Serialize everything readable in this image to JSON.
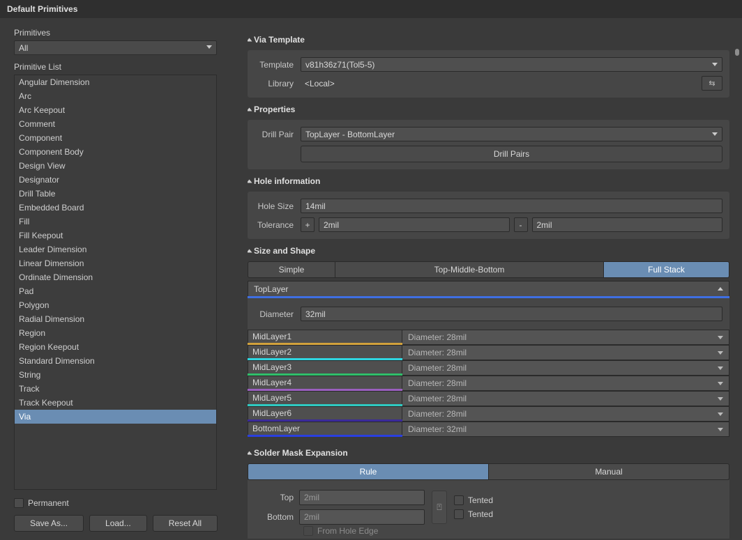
{
  "window": {
    "title": "Default Primitives"
  },
  "left": {
    "primitives_label": "Primitives",
    "primitives_value": "All",
    "list_label": "Primitive List",
    "items": [
      "Angular Dimension",
      "Arc",
      "Arc Keepout",
      "Comment",
      "Component",
      "Component Body",
      "Design View",
      "Designator",
      "Drill Table",
      "Embedded Board",
      "Fill",
      "Fill Keepout",
      "Leader Dimension",
      "Linear Dimension",
      "Ordinate Dimension",
      "Pad",
      "Polygon",
      "Radial Dimension",
      "Region",
      "Region Keepout",
      "Standard Dimension",
      "String",
      "Track",
      "Track Keepout",
      "Via"
    ],
    "selected_index": 24,
    "permanent_label": "Permanent",
    "buttons": {
      "save": "Save As...",
      "load": "Load...",
      "reset": "Reset All"
    }
  },
  "via_template": {
    "header": "Via Template",
    "template_label": "Template",
    "template_value": "v81h36z71(Tol5-5)",
    "library_label": "Library",
    "library_value": "<Local>",
    "link_icon_glyph": "⇆"
  },
  "properties": {
    "header": "Properties",
    "drill_pair_label": "Drill Pair",
    "drill_pair_value": "TopLayer - BottomLayer",
    "drill_pairs_button": "Drill Pairs"
  },
  "hole": {
    "header": "Hole information",
    "size_label": "Hole Size",
    "size_value": "14mil",
    "tolerance_label": "Tolerance",
    "plus": "+",
    "plus_value": "2mil",
    "minus": "-",
    "minus_value": "2mil"
  },
  "size_shape": {
    "header": "Size and Shape",
    "tabs": [
      "Simple",
      "Top-Middle-Bottom",
      "Full Stack"
    ],
    "selected_tab": 2,
    "top_layer": {
      "name": "TopLayer",
      "diameter_label": "Diameter",
      "diameter_value": "32mil",
      "color": "#3f6fe3"
    },
    "layers": [
      {
        "name": "MidLayer1",
        "diameter": "Diameter: 28mil",
        "color": "#d2a23c"
      },
      {
        "name": "MidLayer2",
        "diameter": "Diameter: 28mil",
        "color": "#2fd5e0"
      },
      {
        "name": "MidLayer3",
        "diameter": "Diameter: 28mil",
        "color": "#2fbf6a"
      },
      {
        "name": "MidLayer4",
        "diameter": "Diameter: 28mil",
        "color": "#9a5fbf"
      },
      {
        "name": "MidLayer5",
        "diameter": "Diameter: 28mil",
        "color": "#2fc9c1"
      },
      {
        "name": "MidLayer6",
        "diameter": "Diameter: 28mil",
        "color": "#3a2a9a"
      },
      {
        "name": "BottomLayer",
        "diameter": "Diameter: 32mil",
        "color": "#2a3fe0"
      }
    ]
  },
  "sme": {
    "header": "Solder Mask Expansion",
    "tabs": [
      "Rule",
      "Manual"
    ],
    "selected_tab": 0,
    "top_label": "Top",
    "top_value": "2mil",
    "bottom_label": "Bottom",
    "bottom_value": "2mil",
    "tented_label": "Tented",
    "from_edge": "From Hole Edge",
    "link_glyph": "⍞"
  }
}
